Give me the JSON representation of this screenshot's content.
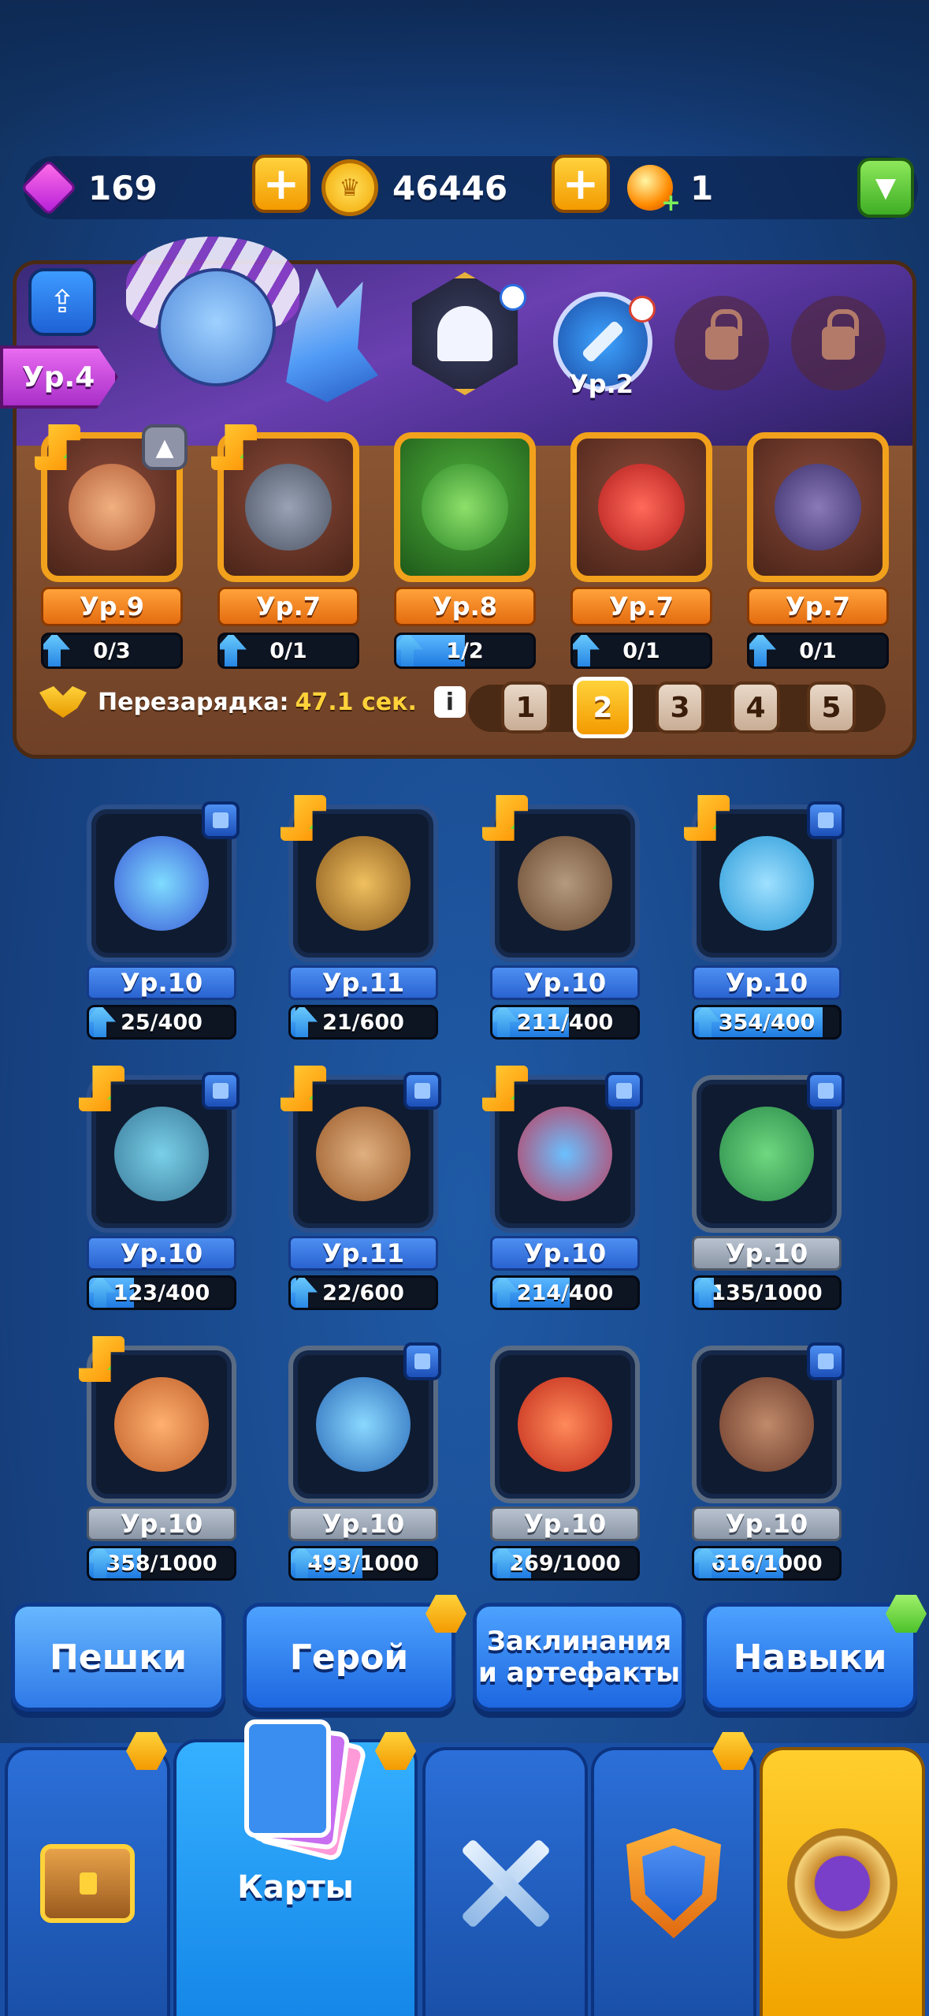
{
  "currency": {
    "gems": "169",
    "coins": "46446",
    "orbs": "1",
    "plus": "+"
  },
  "deck": {
    "player_level": "Ур.4",
    "spell_level": "Ур.2",
    "cards": [
      {
        "level": "Ур.9",
        "progress": "0/3",
        "fill": 0
      },
      {
        "level": "Ур.7",
        "progress": "0/1",
        "fill": 0
      },
      {
        "level": "Ур.8",
        "progress": "1/2",
        "fill": 0.5
      },
      {
        "level": "Ур.7",
        "progress": "0/1",
        "fill": 0
      },
      {
        "level": "Ур.7",
        "progress": "0/1",
        "fill": 0
      }
    ],
    "recharge_label": "Перезарядка:",
    "recharge_value": "47.1 сек.",
    "info": "i",
    "tabs": [
      "1",
      "2",
      "3",
      "4",
      "5"
    ],
    "active_tab": "2"
  },
  "collection": [
    {
      "level": "Ур.10",
      "progress": "25/400",
      "fill": 0.0625
    },
    {
      "level": "Ур.11",
      "progress": "21/600",
      "fill": 0.035
    },
    {
      "level": "Ур.10",
      "progress": "211/400",
      "fill": 0.5275
    },
    {
      "level": "Ур.10",
      "progress": "354/400",
      "fill": 0.885
    },
    {
      "level": "Ур.10",
      "progress": "123/400",
      "fill": 0.3075
    },
    {
      "level": "Ур.11",
      "progress": "22/600",
      "fill": 0.0367
    },
    {
      "level": "Ур.10",
      "progress": "214/400",
      "fill": 0.535
    },
    {
      "level": "Ур.10",
      "progress": "135/1000",
      "fill": 0.135
    },
    {
      "level": "Ур.10",
      "progress": "358/1000",
      "fill": 0.358
    },
    {
      "level": "Ур.10",
      "progress": "493/1000",
      "fill": 0.493
    },
    {
      "level": "Ур.10",
      "progress": "269/1000",
      "fill": 0.269
    },
    {
      "level": "Ур.10",
      "progress": "616/1000",
      "fill": 0.616
    }
  ],
  "categories": {
    "pawns": "Пешки",
    "hero": "Герой",
    "spells_line1": "Заклинания",
    "spells_line2": "и артефакты",
    "skills": "Навыки"
  },
  "nav": {
    "cards": "Карты"
  },
  "colors": {
    "background": "#17468a",
    "gold": "#f39a00",
    "blue_button": "#1d67e0",
    "progress_fill": "#1f7ae0"
  }
}
